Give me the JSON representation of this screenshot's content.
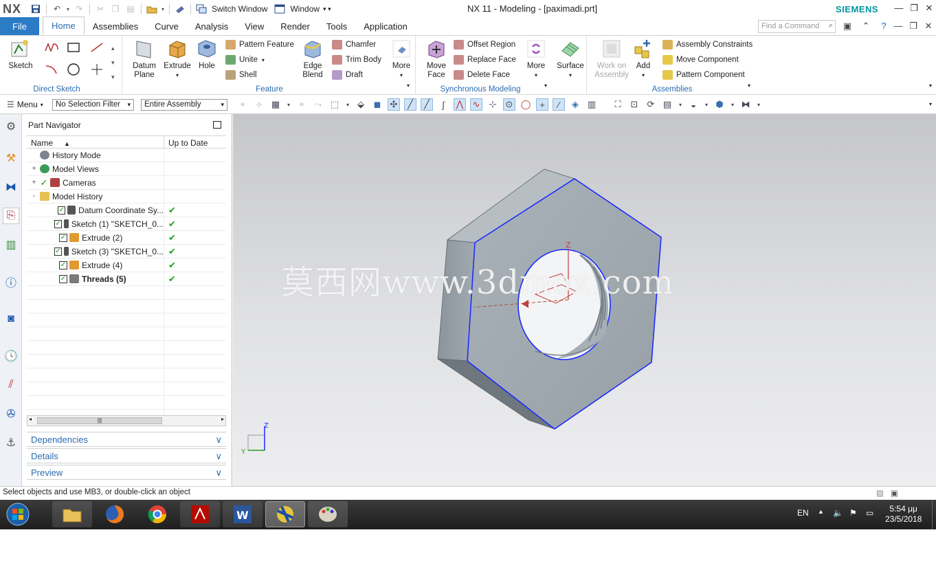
{
  "app": {
    "logo": "NX",
    "window_title": "NX 11 - Modeling - [paximadi.prt]",
    "brand": "SIEMENS",
    "switch_window": "Switch Window",
    "window_menu": "Window"
  },
  "tabs": {
    "file": "File",
    "items": [
      "Home",
      "Assemblies",
      "Curve",
      "Analysis",
      "View",
      "Render",
      "Tools",
      "Application"
    ],
    "active": "Home",
    "find_placeholder": "Find a Command"
  },
  "ribbon": {
    "direct_sketch": {
      "label": "Direct Sketch",
      "sketch": "Sketch"
    },
    "feature": {
      "label": "Feature",
      "datum_plane": "Datum Plane",
      "extrude": "Extrude",
      "hole": "Hole",
      "pattern_feature": "Pattern Feature",
      "unite": "Unite",
      "shell": "Shell",
      "edge_blend": "Edge Blend",
      "chamfer": "Chamfer",
      "trim_body": "Trim Body",
      "draft": "Draft",
      "more": "More"
    },
    "sync": {
      "label": "Synchronous Modeling",
      "move_face": "Move Face",
      "offset_region": "Offset Region",
      "replace_face": "Replace Face",
      "delete_face": "Delete Face",
      "more": "More",
      "surface": "Surface"
    },
    "assemblies": {
      "label": "Assemblies",
      "work_on_assembly": "Work on Assembly",
      "add": "Add",
      "assembly_constraints": "Assembly Constraints",
      "move_component": "Move Component",
      "pattern_component": "Pattern Component"
    }
  },
  "toolbar": {
    "menu": "Menu",
    "selection_filter": "No Selection Filter",
    "scope": "Entire Assembly"
  },
  "navigator": {
    "title": "Part Navigator",
    "col_name": "Name",
    "col_uptodate": "Up to Date",
    "rows": [
      {
        "label": "History Mode",
        "indent": 1,
        "expander": "",
        "check": false,
        "icon": "clock-icon",
        "uptodate": "",
        "bold": false
      },
      {
        "label": "Model Views",
        "indent": 1,
        "expander": "+",
        "check": false,
        "icon": "model-views-icon",
        "uptodate": "",
        "bold": false
      },
      {
        "label": "Cameras",
        "indent": 1,
        "expander": "+",
        "check": true,
        "icon": "camera-icon",
        "uptodate": "",
        "bold": false
      },
      {
        "label": "Model History",
        "indent": 1,
        "expander": "-",
        "check": false,
        "icon": "folder-icon",
        "uptodate": "",
        "bold": false
      },
      {
        "label": "Datum Coordinate Sy...",
        "indent": 2,
        "expander": "",
        "check": true,
        "icon": "datum-csys-icon",
        "uptodate": "✔",
        "bold": false
      },
      {
        "label": "Sketch (1) \"SKETCH_0...",
        "indent": 2,
        "expander": "",
        "check": true,
        "icon": "sketch-icon",
        "uptodate": "✔",
        "bold": false
      },
      {
        "label": "Extrude (2)",
        "indent": 2,
        "expander": "",
        "check": true,
        "icon": "extrude-icon",
        "uptodate": "✔",
        "bold": false
      },
      {
        "label": "Sketch (3) \"SKETCH_0...",
        "indent": 2,
        "expander": "",
        "check": true,
        "icon": "sketch-icon",
        "uptodate": "✔",
        "bold": false
      },
      {
        "label": "Extrude (4)",
        "indent": 2,
        "expander": "",
        "check": true,
        "icon": "extrude-icon",
        "uptodate": "✔",
        "bold": false
      },
      {
        "label": "Threads (5)",
        "indent": 2,
        "expander": "",
        "check": true,
        "icon": "threads-icon",
        "uptodate": "✔",
        "bold": true
      }
    ],
    "empty_rows": 10,
    "dependencies": "Dependencies",
    "details": "Details",
    "preview": "Preview"
  },
  "viewport": {
    "watermark": "莫西网www.3dmox.com",
    "triad": {
      "z": "Z",
      "y": "Y"
    },
    "colors": {
      "part_face": "#a6aeb5",
      "part_dark": "#7d858c",
      "edge_highlight": "#1b2cff"
    }
  },
  "status": {
    "message": "Select objects and use MB3, or double-click an object"
  },
  "taskbar": {
    "lang": "EN",
    "time": "5:54 μμ",
    "date": "23/5/2018"
  }
}
